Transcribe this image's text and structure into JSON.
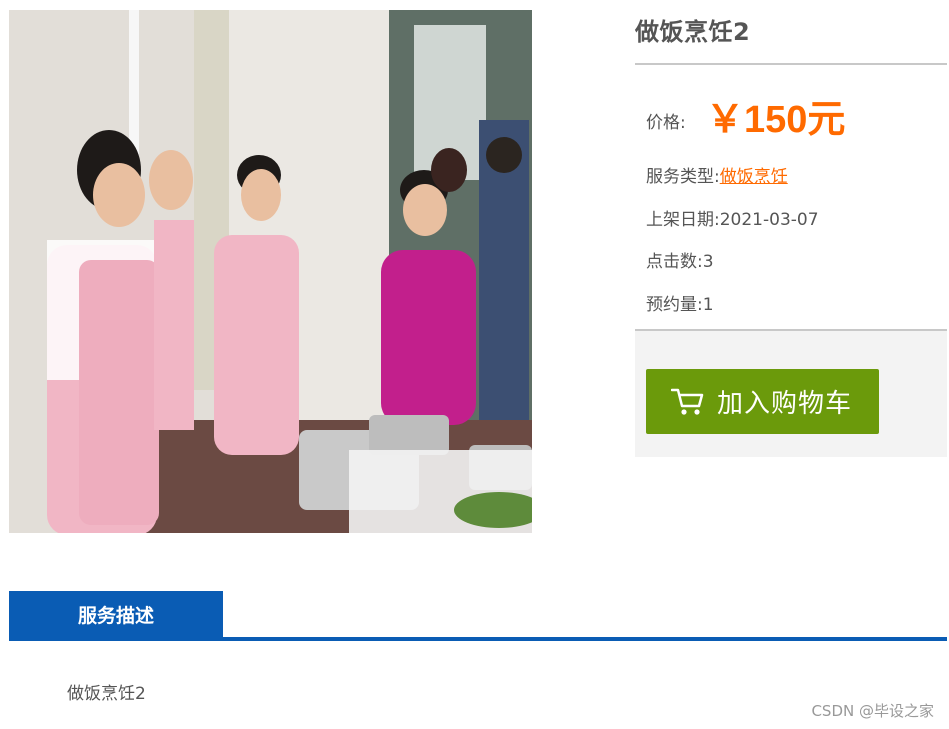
{
  "product": {
    "title": "做饭烹饪2",
    "price_label": "价格:",
    "price_value": "￥150元",
    "type_label": "服务类型:",
    "type_value": "做饭烹饪",
    "date_label": "上架日期:",
    "date_value": "2021-03-07",
    "clicks_label": "点击数:",
    "clicks_value": "3",
    "bookings_label": "预约量:",
    "bookings_value": "1"
  },
  "cart": {
    "label": "加入购物车",
    "icon": "cart-icon"
  },
  "tabs": {
    "description": "服务描述"
  },
  "description": {
    "text": "做饭烹饪2"
  },
  "watermark": "CSDN @毕设之家",
  "colors": {
    "accent": "#ff6a00",
    "button": "#6b9a0b",
    "tab": "#0a5cb4"
  }
}
